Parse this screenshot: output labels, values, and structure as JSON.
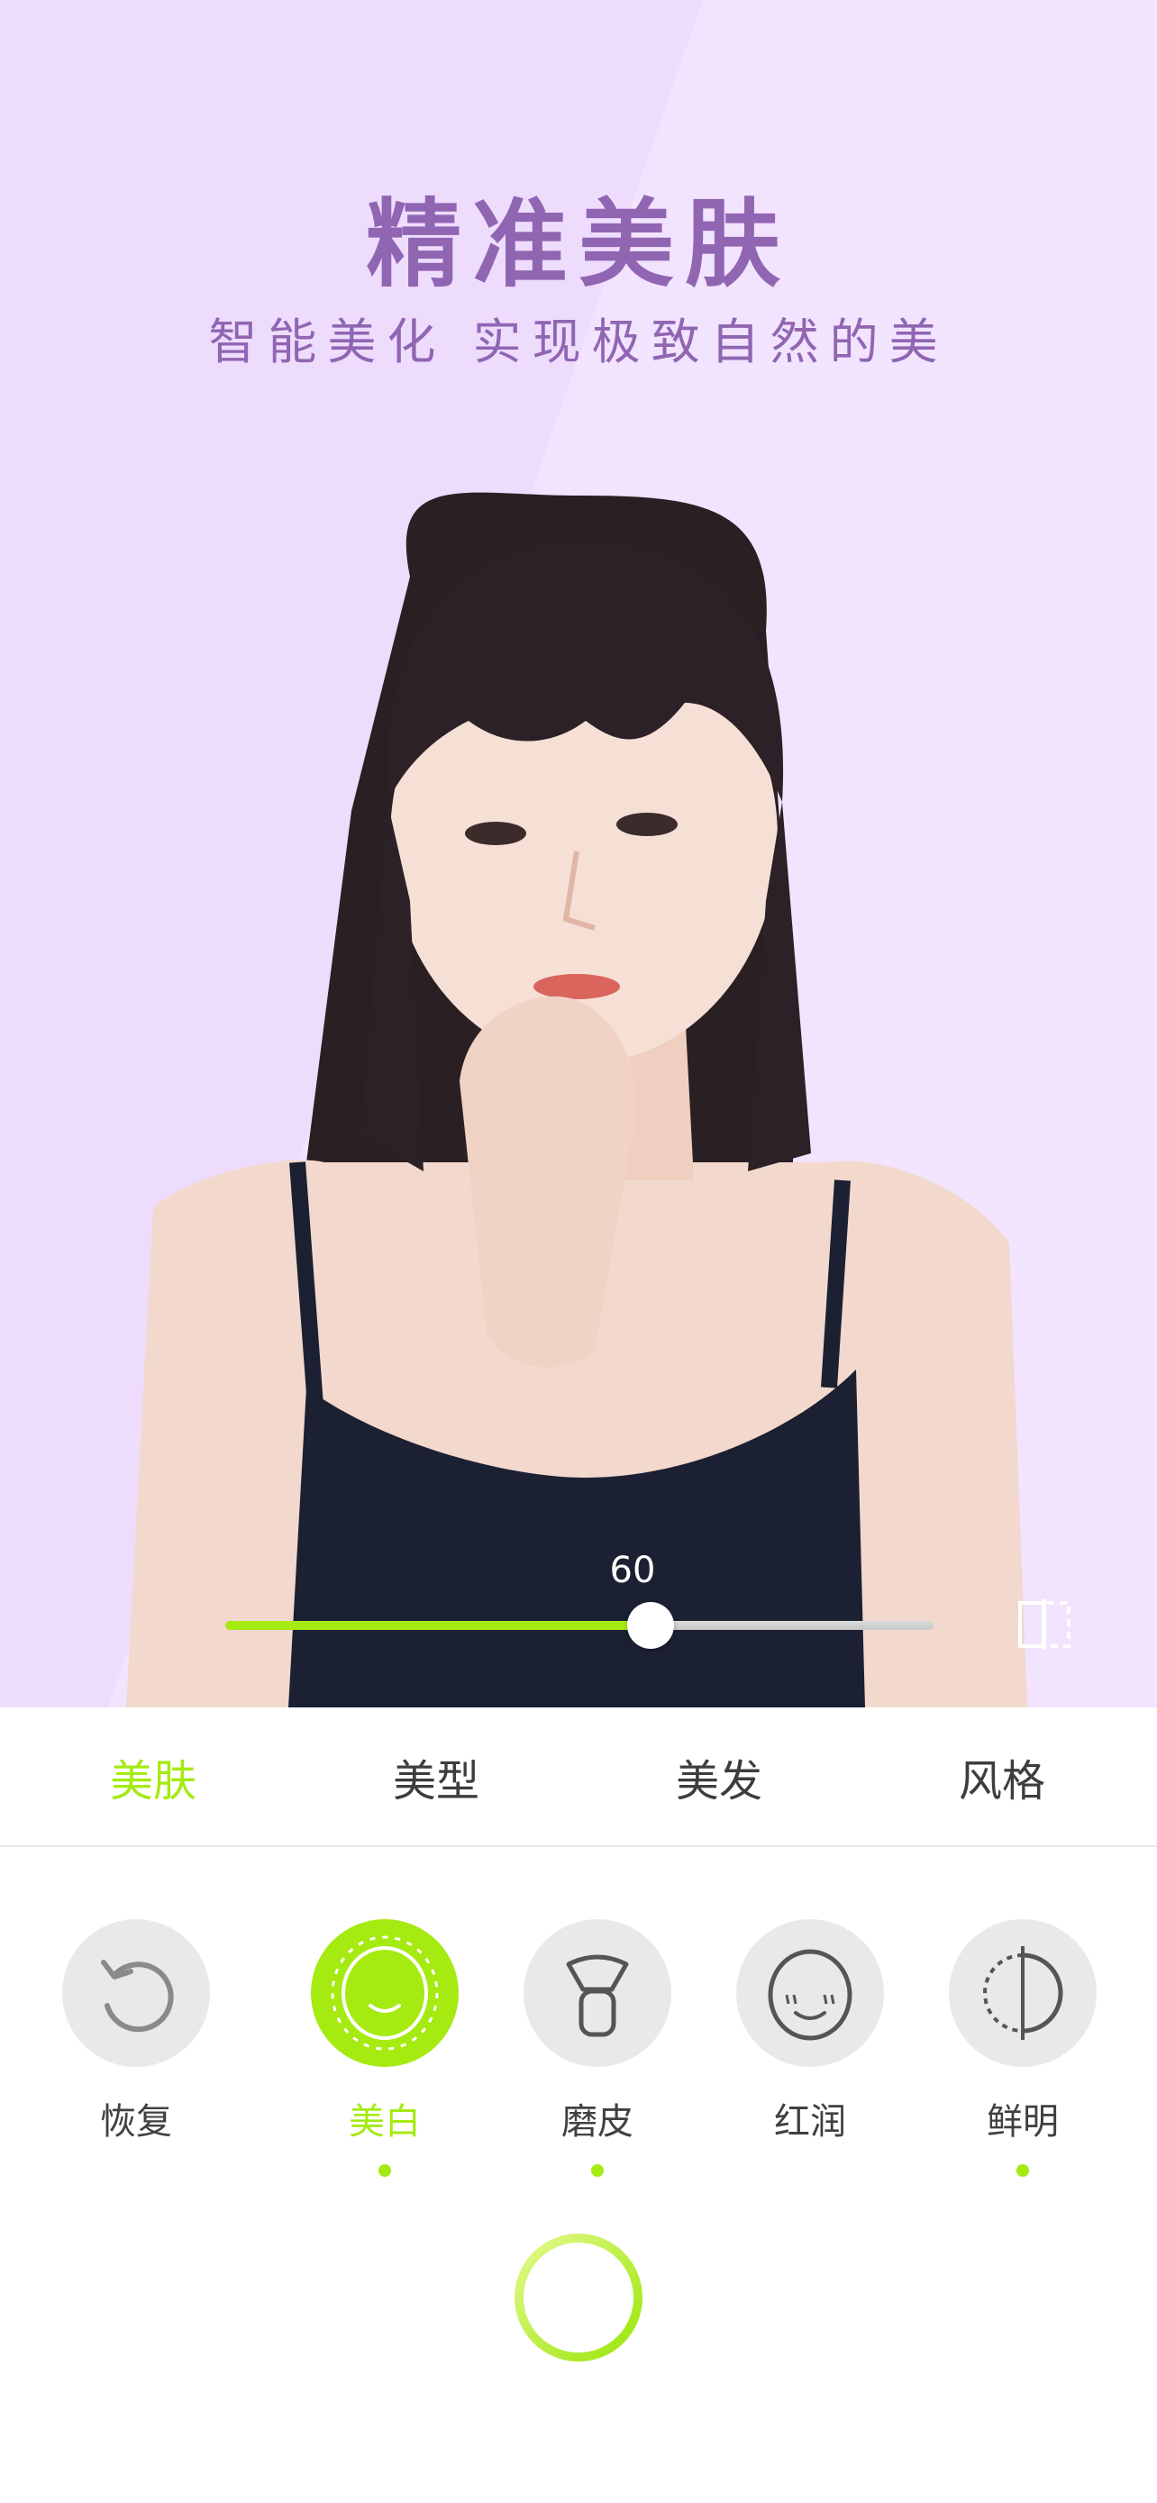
{
  "hero": {
    "title": "精准美肤",
    "subtitle": "智能美化 实现极致自然的美"
  },
  "slider": {
    "value_label": "60",
    "value": 60,
    "max": 100
  },
  "compare_button": {
    "icon": "compare-icon"
  },
  "tabs": [
    {
      "label": "美肤",
      "active": true
    },
    {
      "label": "美型",
      "active": false
    },
    {
      "label": "美发",
      "active": false
    },
    {
      "label": "风格",
      "active": false
    }
  ],
  "tools": [
    {
      "label": "恢复",
      "icon": "reset-icon",
      "active": false,
      "modified": false
    },
    {
      "label": "美白",
      "icon": "whiten-face-icon",
      "active": true,
      "modified": true
    },
    {
      "label": "磨皮",
      "icon": "brush-icon",
      "active": false,
      "modified": true
    },
    {
      "label": "红润",
      "icon": "blush-face-icon",
      "active": false,
      "modified": false
    },
    {
      "label": "鲜明",
      "icon": "contrast-icon",
      "active": false,
      "modified": true
    }
  ],
  "shutter": {
    "icon": "shutter-ring-icon"
  },
  "colors": {
    "accent": "#a5ea11",
    "hero_bg": "#eedcfd",
    "hero_text": "#9065b2",
    "tool_bg": "#e9e9e9"
  }
}
